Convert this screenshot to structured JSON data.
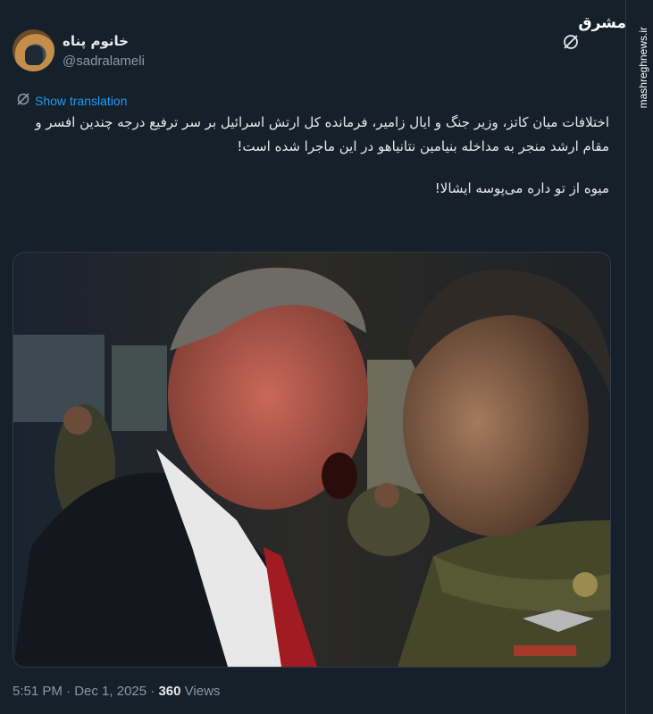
{
  "watermark": {
    "logo": "مشرق",
    "url": "mashreghnews.ir"
  },
  "author": {
    "name": "خانوم پناه",
    "handle": "@sadralameli"
  },
  "translate_label": "Show translation",
  "tweet": {
    "paragraph1": "اختلافات میان کاتز، وزیر جنگ و ایال زامیر، فرمانده کل ارتش اسرائیل بر سر ترفیع درجه چندین افسر و مقام ارشد منجر به مداخله بنیامین نتانیاهو در این ماجرا شده است!",
    "paragraph2": "میوه از تو داره می‌پوسه ایشالا!"
  },
  "footer": {
    "time": "5:51 PM",
    "separator": "·",
    "date": "Dec 1, 2025",
    "views_count": "360",
    "views_label": "Views"
  },
  "icons": {
    "grok": "grok-icon",
    "translate": "translate-icon"
  },
  "colors": {
    "background": "#15202b",
    "link": "#1d9bf0",
    "secondary": "#8b98a5",
    "text": "#e7e9ea"
  }
}
